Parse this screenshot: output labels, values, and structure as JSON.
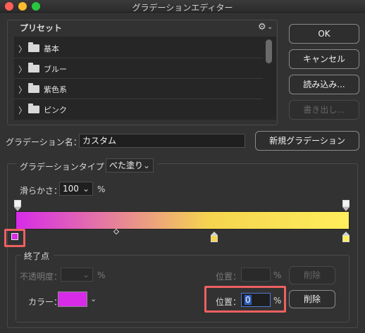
{
  "window": {
    "title": "グラデーションエディター"
  },
  "presets": {
    "label": "プリセット",
    "items": [
      {
        "label": "基本"
      },
      {
        "label": "ブルー"
      },
      {
        "label": "紫色系"
      },
      {
        "label": "ピンク"
      }
    ]
  },
  "buttons": {
    "ok": "OK",
    "cancel": "キャンセル",
    "load": "読み込み...",
    "export": "書き出し...",
    "new_gradient": "新規グラデーション",
    "delete": "削除"
  },
  "name_row": {
    "label": "グラデーション名：",
    "value": "カスタム"
  },
  "type_row": {
    "label": "グラデーションタイプ：",
    "value": "べた塗り"
  },
  "smoothness": {
    "label": "滑らかさ：",
    "value": "100",
    "unit": "%"
  },
  "gradient": {
    "start_color": "#d72be8",
    "mid_color": "#f5d44f",
    "end_color": "#ffee5c"
  },
  "stops": {
    "group_label": "終了点",
    "opacity_label": "不透明度：",
    "opacity_unit": "%",
    "opacity_location_label": "位置：",
    "opacity_location_unit": "%",
    "color_label": "カラー：",
    "color_value": "#d72be8",
    "color_location_label": "位置：",
    "color_location_value": "0",
    "color_location_unit": "%"
  }
}
